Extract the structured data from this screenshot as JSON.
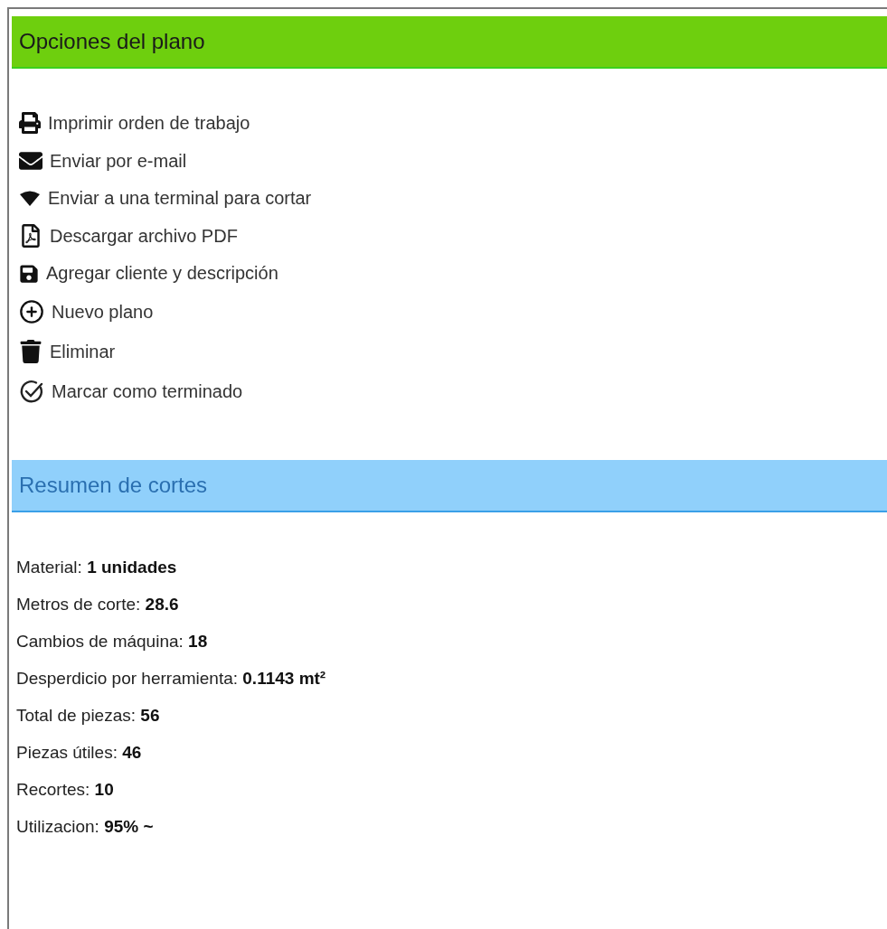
{
  "sections": [
    {
      "kind": "options",
      "title": "Opciones del plano",
      "color": "#6ecf0e",
      "items": [
        {
          "label": "Imprimir orden de trabajo"
        },
        {
          "label": "Enviar por e-mail"
        },
        {
          "label": "Enviar a una terminal para cortar"
        },
        {
          "label": "Descargar archivo PDF"
        },
        {
          "label": "Agregar cliente y descripción"
        },
        {
          "label": "Nuevo plano"
        },
        {
          "label": "Eliminar"
        },
        {
          "label": "Marcar como terminado"
        }
      ]
    },
    {
      "kind": "summary",
      "title": "Resumen de cortes",
      "color": "#90d0fb",
      "items": [
        {
          "label": "Material: **1 unidades**"
        },
        {
          "label": "Metros de corte: **28.6**"
        },
        {
          "label": "Cambios de máquina: **18**"
        },
        {
          "label": "Desperdicio por herramienta: **0.1143 mt²**"
        },
        {
          "label": "Total de piezas: **56**"
        },
        {
          "label": "Piezas útiles: **46**"
        },
        {
          "label": "Recortes: **10**"
        },
        {
          "label": "Utilizacion: **95% ~**"
        }
      ]
    }
  ]
}
